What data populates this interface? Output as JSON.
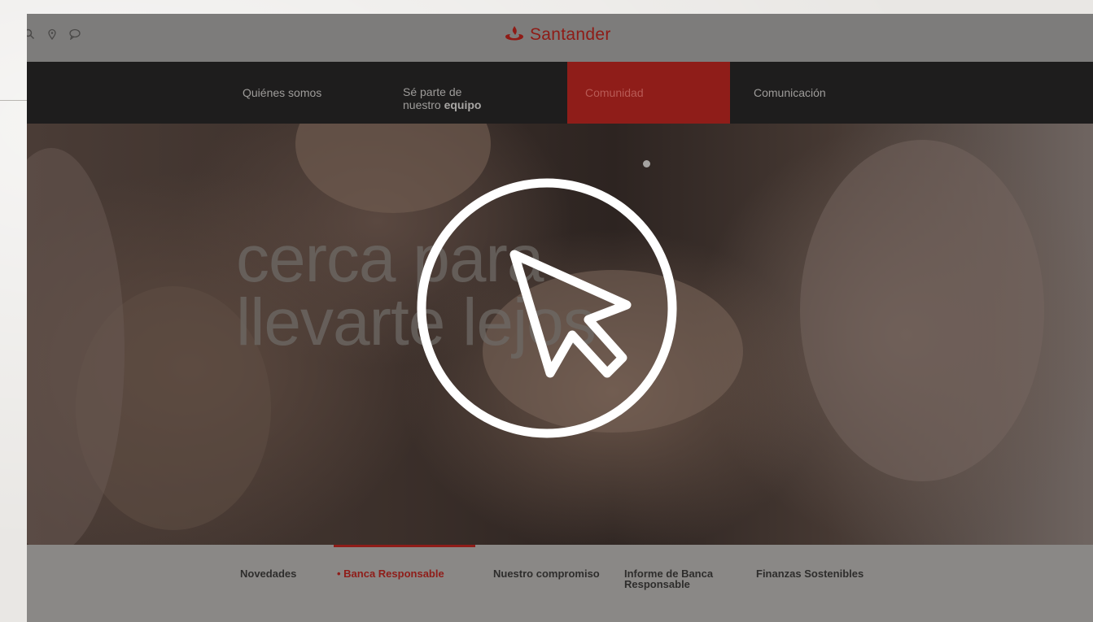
{
  "header": {
    "brand": "Santander",
    "icons": [
      "search-icon",
      "location-icon",
      "chat-icon"
    ]
  },
  "nav": {
    "items": [
      {
        "label": "Quiénes somos"
      },
      {
        "label_line1": "Sé parte de",
        "label_line2_pre": "nuestro ",
        "label_line2_bold": "equipo"
      },
      {
        "label": "Comunidad",
        "active": true
      },
      {
        "label": "Comunicación"
      }
    ]
  },
  "hero": {
    "line1": "cerca para",
    "line2": "llevarte lejos"
  },
  "subnav": {
    "items": [
      {
        "label": "Novedades"
      },
      {
        "label": "• Banca Responsable",
        "active": true
      },
      {
        "label": "Nuestro compromiso"
      },
      {
        "label_line1": "Informe de Banca",
        "label_line2": "Responsable"
      },
      {
        "label": "Finanzas Sostenibles"
      }
    ]
  },
  "overlay": {
    "icon": "cursor-click-icon"
  },
  "colors": {
    "brand_red": "#ec0000",
    "nav_bg": "#1e1d1d",
    "overlay_white": "#ffffff"
  }
}
